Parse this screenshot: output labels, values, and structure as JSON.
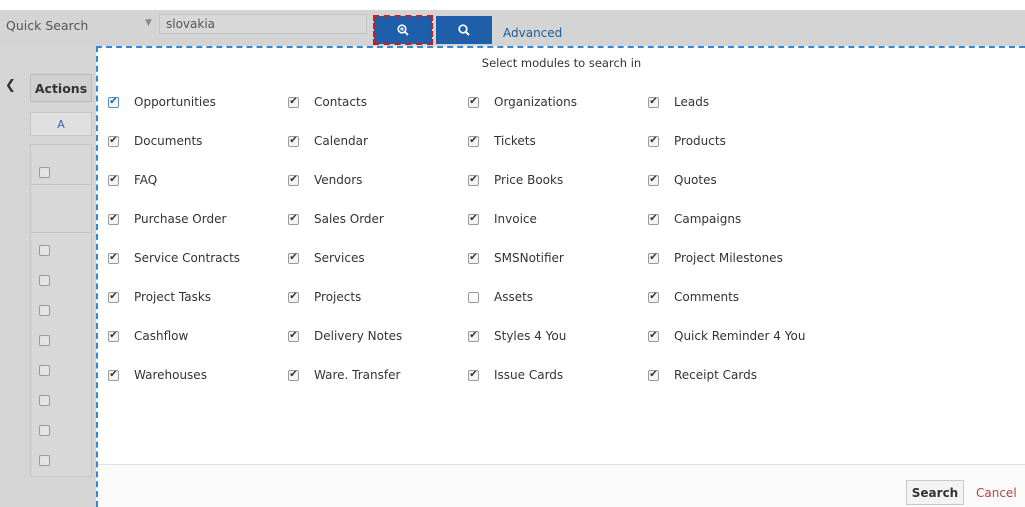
{
  "topbar": {
    "quick_search_label": "Quick Search",
    "dropdown_glyph": "▼",
    "search_value": "slovakia",
    "fuzzy_search_icon": "search-plus-icon",
    "search_icon": "search-icon",
    "advanced_label": "Advanced"
  },
  "background": {
    "collapse_glyph": "❮",
    "actions_label": "Actions",
    "alpha_label": "A"
  },
  "popup": {
    "title": "Select modules to search in",
    "modules": [
      {
        "label": "Opportunities",
        "checked": true
      },
      {
        "label": "Contacts",
        "checked": true
      },
      {
        "label": "Organizations",
        "checked": true
      },
      {
        "label": "Leads",
        "checked": true
      },
      {
        "label": "Documents",
        "checked": true
      },
      {
        "label": "Calendar",
        "checked": true
      },
      {
        "label": "Tickets",
        "checked": true
      },
      {
        "label": "Products",
        "checked": true
      },
      {
        "label": "FAQ",
        "checked": true
      },
      {
        "label": "Vendors",
        "checked": true
      },
      {
        "label": "Price Books",
        "checked": true
      },
      {
        "label": "Quotes",
        "checked": true
      },
      {
        "label": "Purchase Order",
        "checked": true
      },
      {
        "label": "Sales Order",
        "checked": true
      },
      {
        "label": "Invoice",
        "checked": true
      },
      {
        "label": "Campaigns",
        "checked": true
      },
      {
        "label": "Service Contracts",
        "checked": true
      },
      {
        "label": "Services",
        "checked": true
      },
      {
        "label": "SMSNotifier",
        "checked": true
      },
      {
        "label": "Project Milestones",
        "checked": true
      },
      {
        "label": "Project Tasks",
        "checked": true
      },
      {
        "label": "Projects",
        "checked": true
      },
      {
        "label": "Assets",
        "checked": false
      },
      {
        "label": "Comments",
        "checked": true
      },
      {
        "label": "Cashflow",
        "checked": true
      },
      {
        "label": "Delivery Notes",
        "checked": true
      },
      {
        "label": "Styles 4 You",
        "checked": true
      },
      {
        "label": "Quick Reminder 4 You",
        "checked": true
      },
      {
        "label": "Warehouses",
        "checked": true
      },
      {
        "label": "Ware. Transfer",
        "checked": true
      },
      {
        "label": "Issue Cards",
        "checked": true
      },
      {
        "label": "Receipt Cards",
        "checked": true
      }
    ],
    "search_button": "Search",
    "cancel_link": "Cancel"
  },
  "colors": {
    "button_blue": "#1f5ea8",
    "popup_border": "#2f8ad8",
    "highlight_outline": "#d2191f",
    "cancel_red": "#b34444"
  }
}
